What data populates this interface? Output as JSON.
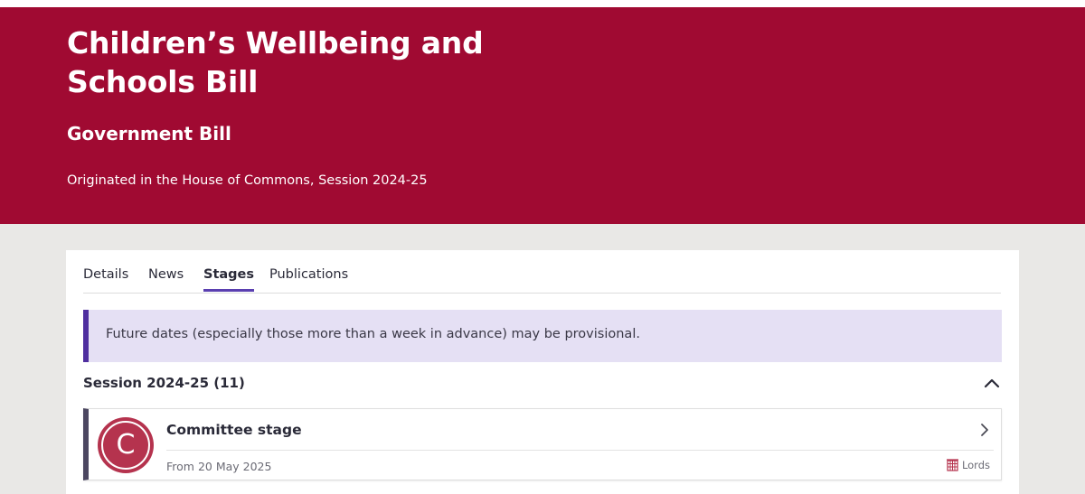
{
  "bill": {
    "title": "Children’s Wellbeing and Schools Bill",
    "type": "Government Bill",
    "origin": "Originated in the House of Commons, Session 2024-25"
  },
  "tabs": [
    {
      "label": "Details"
    },
    {
      "label": "News"
    },
    {
      "label": "Stages",
      "active": true
    },
    {
      "label": "Publications"
    }
  ],
  "notice": "Future dates (especially those more than a week in advance) may be provisional.",
  "session": {
    "title": "Session 2024-25 (11)",
    "toggle_icon": "chevron-up-icon"
  },
  "stages": [
    {
      "badge_letter": "C",
      "name": "Committee stage",
      "date": "From 20 May 2025",
      "house": "Lords",
      "house_icon": "portcullis-icon",
      "chevron_icon": "chevron-right-icon"
    }
  ],
  "colors": {
    "hero_bg": "#a00a32",
    "page_bg": "#e9e8e6",
    "accent_purple": "#4f2e9f",
    "notice_bg": "#e5e0f4",
    "lords_red": "#b5334e"
  }
}
